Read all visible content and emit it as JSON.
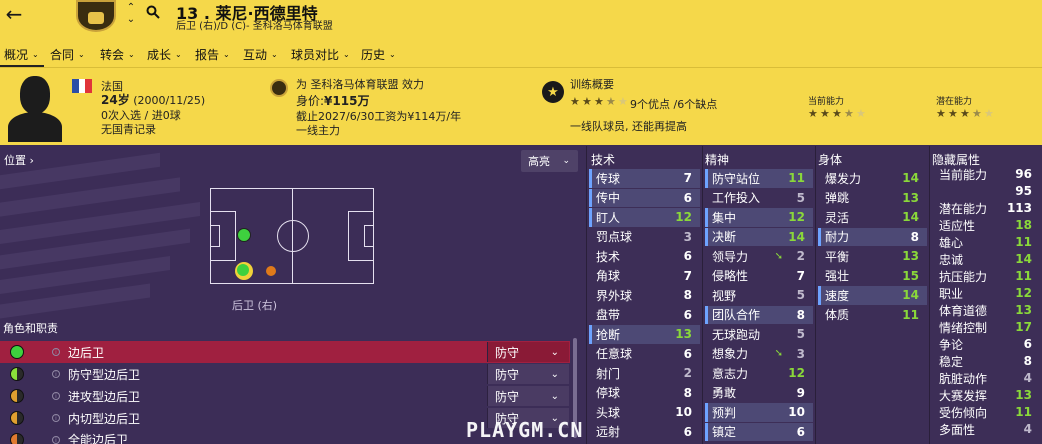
{
  "player": {
    "number": "13 .",
    "name": "莱尼·西德里特",
    "subtitle": "后卫 (右)/D (C)- 圣科洛马体育联盟"
  },
  "nav": [
    "概况",
    "合同",
    "转会",
    "成长",
    "报告",
    "互动",
    "球员对比",
    "历史"
  ],
  "bio": {
    "nation": "法国",
    "age": "24岁",
    "dob": "(2000/11/25)",
    "caps": "0次入选 / 进0球",
    "youth": "无国青记录"
  },
  "club": {
    "line": "为 圣科洛马体育联盟 效力",
    "value_label": "身价:",
    "value": "¥115万",
    "contract": "截止2027/6/30工资为¥114万/年",
    "status": "一线主力"
  },
  "training": {
    "title": "训练概要",
    "prefix": "9个优点 /",
    "suffix": "6个缺点",
    "note": "一线队球员, 还能再提高",
    "current_label": "当前能力",
    "potential_label": "潜在能力",
    "summary_stars": 3.5,
    "current_stars": 3.5,
    "potential_stars": 3.5
  },
  "position": {
    "label": "位置",
    "dropdown": "高亮",
    "pitch_label": "后卫 (右)"
  },
  "roles": {
    "title": "角色和职责",
    "items": [
      {
        "name": "边后卫",
        "duty": "防守",
        "color": "#3ed13e",
        "selected": true
      },
      {
        "name": "防守型边后卫",
        "duty": "防守",
        "color": "#8be03a",
        "selected": false
      },
      {
        "name": "进攻型边后卫",
        "duty": "防守",
        "color": "#e0a030",
        "selected": false
      },
      {
        "name": "内切型边后卫",
        "duty": "防守",
        "color": "#e0a030",
        "selected": false
      },
      {
        "name": "全能边后卫",
        "duty": "",
        "color": "#e07a30",
        "selected": false
      }
    ]
  },
  "technical": {
    "title": "技术",
    "items": [
      {
        "n": "传球",
        "v": "7",
        "c": "white",
        "h": true
      },
      {
        "n": "传中",
        "v": "6",
        "c": "white",
        "h": true
      },
      {
        "n": "盯人",
        "v": "12",
        "c": "green",
        "h": true
      },
      {
        "n": "罚点球",
        "v": "3",
        "c": "grey",
        "h": false
      },
      {
        "n": "技术",
        "v": "6",
        "c": "white",
        "h": false
      },
      {
        "n": "角球",
        "v": "7",
        "c": "white",
        "h": false
      },
      {
        "n": "界外球",
        "v": "8",
        "c": "white",
        "h": false
      },
      {
        "n": "盘带",
        "v": "6",
        "c": "white",
        "h": false
      },
      {
        "n": "抢断",
        "v": "13",
        "c": "green",
        "h": true
      },
      {
        "n": "任意球",
        "v": "6",
        "c": "white",
        "h": false
      },
      {
        "n": "射门",
        "v": "2",
        "c": "grey",
        "h": false
      },
      {
        "n": "停球",
        "v": "8",
        "c": "white",
        "h": false
      },
      {
        "n": "头球",
        "v": "10",
        "c": "white",
        "h": false
      },
      {
        "n": "远射",
        "v": "6",
        "c": "white",
        "h": false
      }
    ]
  },
  "mental": {
    "title": "精神",
    "items": [
      {
        "n": "防守站位",
        "v": "11",
        "c": "green",
        "h": true
      },
      {
        "n": "工作投入",
        "v": "5",
        "c": "grey",
        "h": false
      },
      {
        "n": "集中",
        "v": "12",
        "c": "green",
        "h": true
      },
      {
        "n": "决断",
        "v": "14",
        "c": "green",
        "h": true
      },
      {
        "n": "领导力",
        "v": "2",
        "c": "grey",
        "h": false,
        "arrow": true
      },
      {
        "n": "侵略性",
        "v": "7",
        "c": "white",
        "h": false
      },
      {
        "n": "视野",
        "v": "5",
        "c": "grey",
        "h": false
      },
      {
        "n": "团队合作",
        "v": "8",
        "c": "white",
        "h": true
      },
      {
        "n": "无球跑动",
        "v": "5",
        "c": "grey",
        "h": false
      },
      {
        "n": "想象力",
        "v": "3",
        "c": "grey",
        "h": false,
        "arrow": true
      },
      {
        "n": "意志力",
        "v": "12",
        "c": "green",
        "h": false
      },
      {
        "n": "勇敢",
        "v": "9",
        "c": "white",
        "h": false
      },
      {
        "n": "预判",
        "v": "10",
        "c": "white",
        "h": true
      },
      {
        "n": "镇定",
        "v": "6",
        "c": "white",
        "h": true
      }
    ]
  },
  "physical": {
    "title": "身体",
    "items": [
      {
        "n": "爆发力",
        "v": "14",
        "c": "green",
        "h": false
      },
      {
        "n": "弹跳",
        "v": "13",
        "c": "green",
        "h": false
      },
      {
        "n": "灵活",
        "v": "14",
        "c": "green",
        "h": false
      },
      {
        "n": "耐力",
        "v": "8",
        "c": "white",
        "h": true
      },
      {
        "n": "平衡",
        "v": "13",
        "c": "green",
        "h": false
      },
      {
        "n": "强壮",
        "v": "15",
        "c": "green",
        "h": false
      },
      {
        "n": "速度",
        "v": "14",
        "c": "green",
        "h": true
      },
      {
        "n": "体质",
        "v": "11",
        "c": "green",
        "h": false
      }
    ]
  },
  "hidden": {
    "title": "隐藏属性",
    "items": [
      {
        "n": "当前能力",
        "v": "96",
        "c": "white"
      },
      {
        "n": "",
        "v": "95",
        "c": "white"
      },
      {
        "n": "潜在能力",
        "v": "113",
        "c": "white"
      },
      {
        "n": "适应性",
        "v": "18",
        "c": "green"
      },
      {
        "n": "雄心",
        "v": "11",
        "c": "green"
      },
      {
        "n": "忠诚",
        "v": "14",
        "c": "green"
      },
      {
        "n": "抗压能力",
        "v": "11",
        "c": "green"
      },
      {
        "n": "职业",
        "v": "12",
        "c": "green"
      },
      {
        "n": "体育道德",
        "v": "13",
        "c": "green"
      },
      {
        "n": "情绪控制",
        "v": "17",
        "c": "green"
      },
      {
        "n": "争论",
        "v": "6",
        "c": "white"
      },
      {
        "n": "稳定",
        "v": "8",
        "c": "white"
      },
      {
        "n": "肮脏动作",
        "v": "4",
        "c": "grey"
      },
      {
        "n": "大赛发挥",
        "v": "13",
        "c": "green"
      },
      {
        "n": "受伤倾向",
        "v": "11",
        "c": "green"
      },
      {
        "n": "多面性",
        "v": "4",
        "c": "grey"
      }
    ]
  },
  "watermark": "PLAYGM.CN",
  "colors": {
    "header": "#f5d84a",
    "panel": "#3c2d57",
    "green": "#8ad83a",
    "highlight": "#4d4975"
  }
}
